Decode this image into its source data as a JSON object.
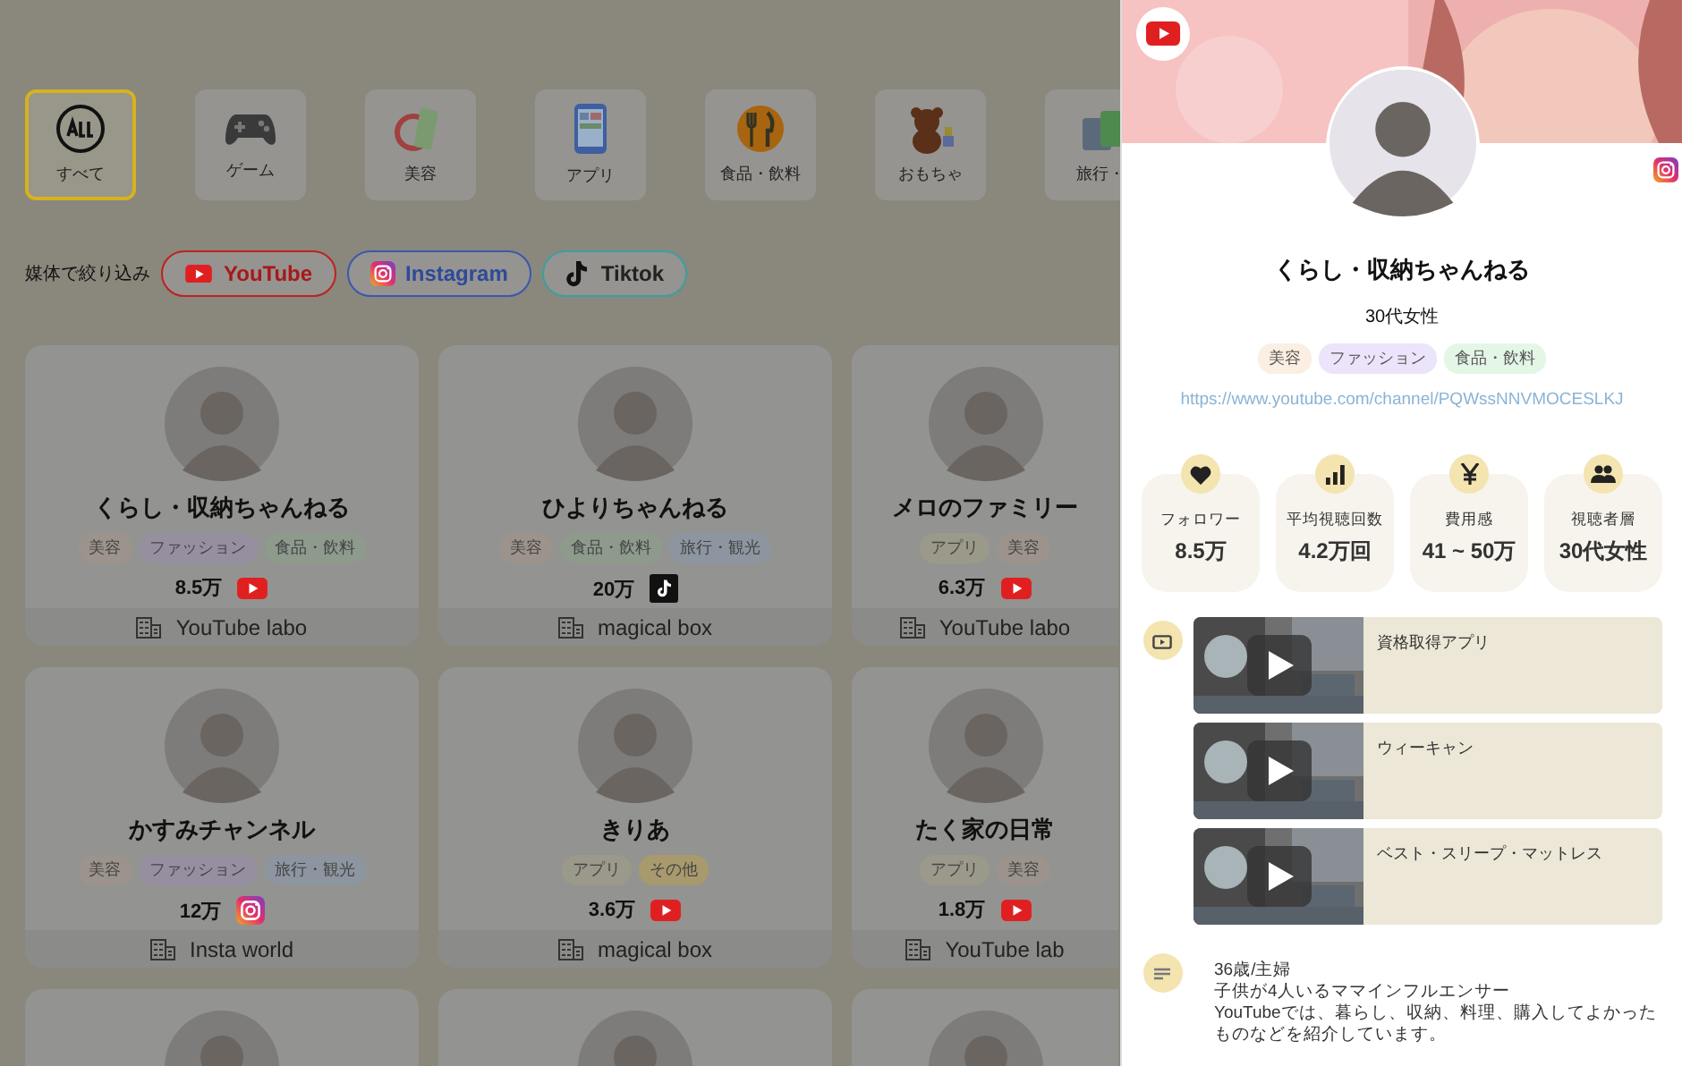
{
  "categories": [
    {
      "label": "すべて",
      "kind": "all",
      "selected": true
    },
    {
      "label": "ゲーム",
      "kind": "game",
      "selected": false
    },
    {
      "label": "美容",
      "kind": "beauty",
      "selected": false
    },
    {
      "label": "アプリ",
      "kind": "app",
      "selected": false
    },
    {
      "label": "食品・飲料",
      "kind": "food",
      "selected": false
    },
    {
      "label": "おもちゃ",
      "kind": "toy",
      "selected": false
    },
    {
      "label": "旅行・",
      "kind": "travel",
      "selected": false
    }
  ],
  "filter": {
    "label": "媒体で絞り込み",
    "buttons": [
      {
        "label": "YouTube",
        "kind": "youtube"
      },
      {
        "label": "Instagram",
        "kind": "instagram"
      },
      {
        "label": "Tiktok",
        "kind": "tiktok"
      }
    ]
  },
  "cards": [
    {
      "kind": "full",
      "name": "くらし・収納ちゃんねる",
      "tags": [
        {
          "label": "美容",
          "color": "#9c948c"
        },
        {
          "label": "ファッション",
          "color": "#968fa0"
        },
        {
          "label": "食品・飲料",
          "color": "#8d9a8c"
        }
      ],
      "count": "8.5万",
      "platform": {
        "kind": "youtube"
      },
      "agency": "YouTube labo"
    },
    {
      "kind": "full",
      "name": "ひよりちゃんねる",
      "tags": [
        {
          "label": "美容",
          "color": "#9c948c"
        },
        {
          "label": "食品・飲料",
          "color": "#8d9a8c"
        },
        {
          "label": "旅行・観光",
          "color": "#8d96a0"
        }
      ],
      "count": "20万",
      "platform": {
        "kind": "tiktok"
      },
      "agency": "magical box"
    },
    {
      "kind": "full",
      "name": "メロのファミリー",
      "tags": [
        {
          "label": "アプリ",
          "color": "#9a998a"
        },
        {
          "label": "美容",
          "color": "#9c948c"
        }
      ],
      "count": "6.3万",
      "platform": {
        "kind": "youtube"
      },
      "agency": "YouTube labo"
    },
    {
      "kind": "full",
      "name": "かすみチャンネル",
      "tags": [
        {
          "label": "美容",
          "color": "#9c948c"
        },
        {
          "label": "ファッション",
          "color": "#968fa0"
        },
        {
          "label": "旅行・観光",
          "color": "#8d96a0"
        }
      ],
      "count": "12万",
      "platform": {
        "kind": "instagram"
      },
      "agency": "Insta world"
    },
    {
      "kind": "full",
      "name": "きりあ",
      "tags": [
        {
          "label": "アプリ",
          "color": "#9a998a"
        },
        {
          "label": "その他",
          "color": "#a89a6c"
        }
      ],
      "count": "3.6万",
      "platform": {
        "kind": "youtube"
      },
      "agency": "magical box"
    },
    {
      "kind": "full",
      "name": "たく家の日常",
      "tags": [
        {
          "label": "アプリ",
          "color": "#9a998a"
        },
        {
          "label": "美容",
          "color": "#9c948c"
        }
      ],
      "count": "1.8万",
      "platform": {
        "kind": "youtube"
      },
      "agency": "YouTube lab"
    },
    {
      "kind": "cut"
    },
    {
      "kind": "cut"
    },
    {
      "kind": "cut"
    }
  ],
  "drawer": {
    "platform": {
      "kind": "youtube"
    },
    "linked_accounts": [
      {
        "kind": "instagram"
      }
    ],
    "name": "くらし・収納ちゃんねる",
    "audience": "30代女性",
    "tags": [
      {
        "label": "美容",
        "color": "#fbeee2"
      },
      {
        "label": "ファッション",
        "color": "#ece4fb"
      },
      {
        "label": "食品・飲料",
        "color": "#e4f6e6"
      }
    ],
    "url": "https://www.youtube.com/channel/PQWssNNVMOCESLKJ",
    "stats": [
      {
        "kind": "heart",
        "label": "フォロワー",
        "value": "8.5万"
      },
      {
        "kind": "bars",
        "label": "平均視聴回数",
        "value": "4.2万回"
      },
      {
        "kind": "yen",
        "label": "費用感",
        "value": "41 ~ 50万"
      },
      {
        "kind": "people",
        "label": "視聴者層",
        "value": "30代女性"
      }
    ],
    "videos": [
      {
        "title": "資格取得アプリ"
      },
      {
        "title": "ウィーキャン"
      },
      {
        "title": "ベスト・スリープ・マットレス"
      }
    ],
    "description": [
      "36歳/主婦",
      "子供が4人いるママインフルエンサー",
      "YouTubeでは、暮らし、収納、料理、購入してよかったものなどを紹介しています。"
    ]
  }
}
